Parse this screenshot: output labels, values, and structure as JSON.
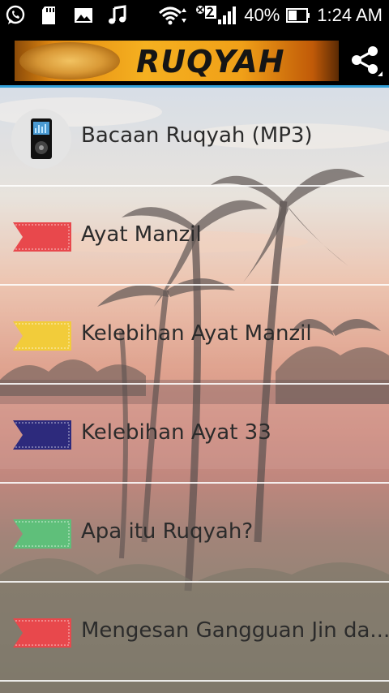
{
  "status_bar": {
    "battery": "40%",
    "time": "1:24 AM",
    "icons": [
      "whatsapp-icon",
      "sd-card-icon",
      "image-icon",
      "music-icon",
      "wifi-icon",
      "signal-icon",
      "battery-icon"
    ]
  },
  "action_bar": {
    "title": "RUQYAH",
    "share_icon": "share-icon"
  },
  "list": {
    "items": [
      {
        "label": "Bacaan Ruqyah (MP3)",
        "icon": "mp3-player-icon"
      },
      {
        "label": "Ayat Manzil",
        "icon": "ribbon-icon",
        "color": "#e8484c"
      },
      {
        "label": "Kelebihan Ayat Manzil",
        "icon": "ribbon-icon",
        "color": "#f2cc3a"
      },
      {
        "label": "Kelebihan Ayat 33",
        "icon": "ribbon-icon",
        "color": "#2d2a7c"
      },
      {
        "label": "Apa itu Ruqyah?",
        "icon": "ribbon-icon",
        "color": "#5fbf7a"
      },
      {
        "label": "Mengesan Gangguan Jin da...",
        "icon": "ribbon-icon",
        "color": "#e8484c"
      }
    ]
  }
}
